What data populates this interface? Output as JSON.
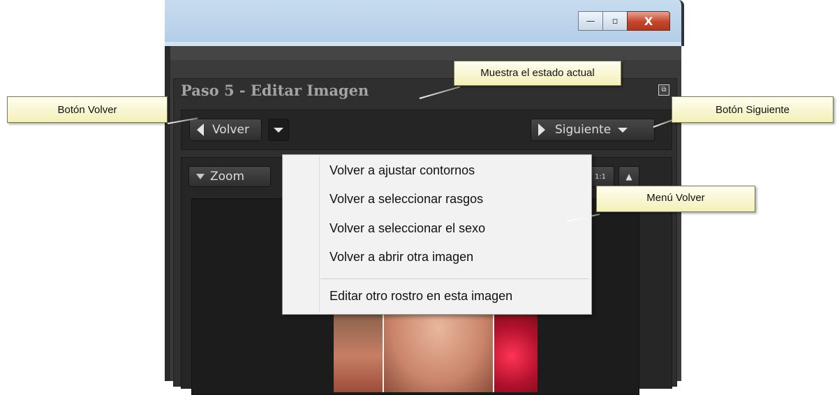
{
  "window": {
    "buttons": {
      "minimize": "—",
      "maximize": "▫",
      "close": "X"
    }
  },
  "panel": {
    "title": "Paso 5 - Editar Imagen",
    "float_icon": "restore-window-icon"
  },
  "nav": {
    "back_label": "Volver",
    "next_label": "Siguiente",
    "zoom_label": "Zoom",
    "one_to_one_label": "1:1"
  },
  "back_menu": {
    "items": [
      "Volver a ajustar contornos",
      "Volver a seleccionar rasgos",
      "Volver a seleccionar el sexo",
      "Volver a abrir otra imagen",
      "Editar otro rostro en esta imagen"
    ]
  },
  "callouts": {
    "state": "Muestra el estado actual",
    "back_button": "Botón Volver",
    "next_button": "Botón Siguiente",
    "back_menu": "Menú Volver"
  },
  "colors": {
    "callout_bg": "#fbf8c8",
    "panel_bg": "#2f2f2f",
    "menu_bg": "#f2f2f2"
  }
}
